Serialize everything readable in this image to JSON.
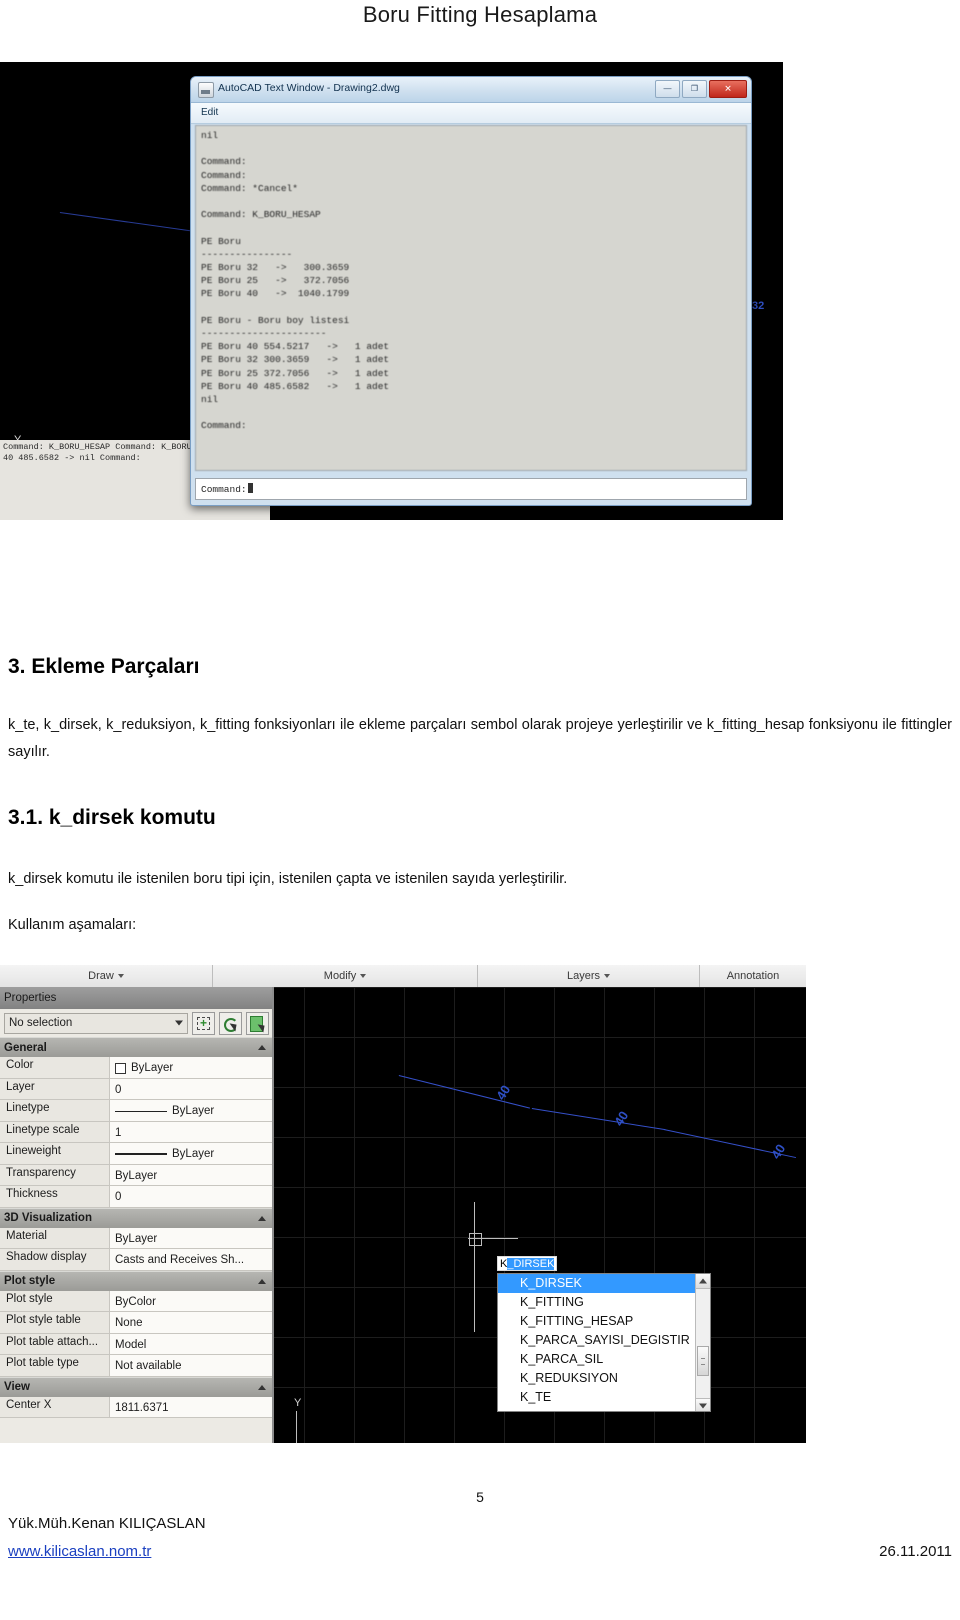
{
  "document": {
    "title": "Boru Fitting Hesaplama",
    "page_number": "5",
    "footer": {
      "author": "Yük.Müh.Kenan KILIÇASLAN",
      "website": "www.kilicaslan.nom.tr",
      "date": "26.11.2011"
    }
  },
  "sections": [
    {
      "heading": "3. Ekleme Parçaları",
      "paragraph": "k_te, k_dirsek, k_reduksiyon, k_fitting fonksiyonları ile ekleme parçaları sembol olarak projeye yerleştirilir ve k_fitting_hesap fonksiyonu ile fittingler sayılır."
    },
    {
      "heading": "3.1. k_dirsek komutu",
      "paragraph": "k_dirsek komutu ile istenilen boru tipi için, istenilen çapta ve istenilen sayıda yerleştirilir.",
      "usage_label": "Kullanım aşamaları:"
    }
  ],
  "figure1": {
    "text_window": {
      "title": "AutoCAD Text Window - Drawing2.dwg",
      "menu": "Edit",
      "window_buttons": {
        "minimize": "—",
        "maximize": "❐",
        "close": "✕"
      },
      "content": "nil\n\nCommand:\nCommand:\nCommand: *Cancel*\n\nCommand: K_BORU_HESAP\n\nPE Boru\n----------------\nPE Boru 32   ->   300.3659\nPE Boru 25   ->   372.7056\nPE Boru 40   ->  1040.1799\n\nPE Boru - Boru boy listesi\n----------------------\nPE Boru 40 554.5217   ->   1 adet\nPE Boru 32 300.3659   ->   1 adet\nPE Boru 25 372.7056   ->   1 adet\nPE Boru 40 485.6582   ->   1 adet\nnil\n\nCommand:",
      "input_prompt": "Command:"
    },
    "drawing": {
      "ucs_y_label": "Y",
      "dimension_label": "32",
      "command_history": "Command: K_BORU_HESAP\nCommand: K_BORU_HESAP\nPE Boru 40 485.6582   ->\nnil\nCommand:"
    }
  },
  "figure2": {
    "ribbon_panels": [
      {
        "label": "Draw",
        "has_dropdown": true
      },
      {
        "label": "Modify",
        "has_dropdown": true
      },
      {
        "label": "Layers",
        "has_dropdown": true
      },
      {
        "label": "Annotation",
        "has_dropdown": false
      }
    ],
    "properties_palette": {
      "title": "Properties",
      "selection": "No selection",
      "toolbar_buttons": [
        "quick-select-icon",
        "select-objects-icon",
        "toggle-value-icon"
      ],
      "groups": [
        {
          "name": "General",
          "rows": [
            {
              "key": "Color",
              "value": "ByLayer",
              "value_type": "color"
            },
            {
              "key": "Layer",
              "value": "0",
              "value_type": "text"
            },
            {
              "key": "Linetype",
              "value": "ByLayer",
              "value_type": "linetype"
            },
            {
              "key": "Linetype scale",
              "value": "1",
              "value_type": "text"
            },
            {
              "key": "Lineweight",
              "value": "ByLayer",
              "value_type": "lineweight"
            },
            {
              "key": "Transparency",
              "value": "ByLayer",
              "value_type": "text"
            },
            {
              "key": "Thickness",
              "value": "0",
              "value_type": "text"
            }
          ]
        },
        {
          "name": "3D Visualization",
          "rows": [
            {
              "key": "Material",
              "value": "ByLayer",
              "value_type": "text"
            },
            {
              "key": "Shadow display",
              "value": "Casts and Receives Sh...",
              "value_type": "text"
            }
          ]
        },
        {
          "name": "Plot style",
          "rows": [
            {
              "key": "Plot style",
              "value": "ByColor",
              "value_type": "text"
            },
            {
              "key": "Plot style table",
              "value": "None",
              "value_type": "text"
            },
            {
              "key": "Plot table attach...",
              "value": "Model",
              "value_type": "text"
            },
            {
              "key": "Plot table type",
              "value": "Not available",
              "value_type": "text"
            }
          ]
        },
        {
          "name": "View",
          "rows": [
            {
              "key": "Center X",
              "value": "1811.6371",
              "value_type": "text"
            }
          ]
        }
      ]
    },
    "command_entry": {
      "typed_prefix": "K",
      "completion_suffix": "_DIRSEK"
    },
    "autocomplete": {
      "items": [
        "K_DIRSEK",
        "K_FITTING",
        "K_FITTING_HESAP",
        "K_PARCA_SAYISI_DEGISTIR",
        "K_PARCA_SIL",
        "K_REDUKSIYON",
        "K_TE"
      ],
      "selected_index": 0
    },
    "drawing": {
      "ucs_y_label": "Y",
      "dimension_labels": [
        "40",
        "40",
        "40"
      ]
    }
  },
  "colors": {
    "autocad_accent_blue": "#3399ff",
    "pipe_line_blue": "#3550c9",
    "link_blue": "#1a3fc0",
    "close_button_red": "#c0271b"
  }
}
